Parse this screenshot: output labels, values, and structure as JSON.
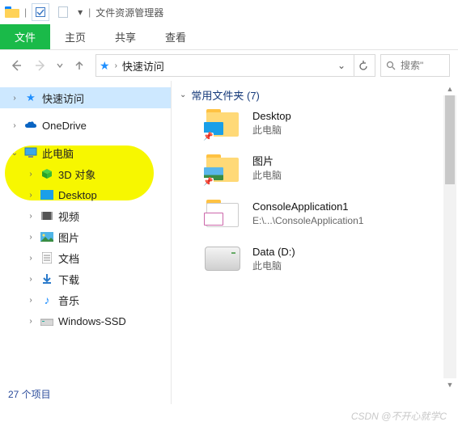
{
  "title": "文件资源管理器",
  "ribbon": {
    "tabs": [
      "文件",
      "主页",
      "共享",
      "查看"
    ],
    "active": 0
  },
  "address": {
    "label": "快速访问"
  },
  "search": {
    "placeholder": "搜索\""
  },
  "sidebar": {
    "quick_access": "快速访问",
    "onedrive": "OneDrive",
    "this_pc": "此电脑",
    "nodes": [
      "3D 对象",
      "Desktop",
      "视频",
      "图片",
      "文档",
      "下载",
      "音乐",
      "Windows-SSD"
    ]
  },
  "content": {
    "group_label": "常用文件夹 (7)",
    "items": [
      {
        "name": "Desktop",
        "loc": "此电脑",
        "pinned": true,
        "thumb": "desktop"
      },
      {
        "name": "图片",
        "loc": "此电脑",
        "pinned": true,
        "thumb": "pictures"
      },
      {
        "name": "ConsoleApplication1",
        "loc": "E:\\...\\ConsoleApplication1",
        "pinned": false,
        "thumb": "app"
      },
      {
        "name": "Data (D:)",
        "loc": "此电脑",
        "pinned": false,
        "thumb": "drive"
      }
    ]
  },
  "status": "27 个项目",
  "watermark": "CSDN @不开心就学C"
}
